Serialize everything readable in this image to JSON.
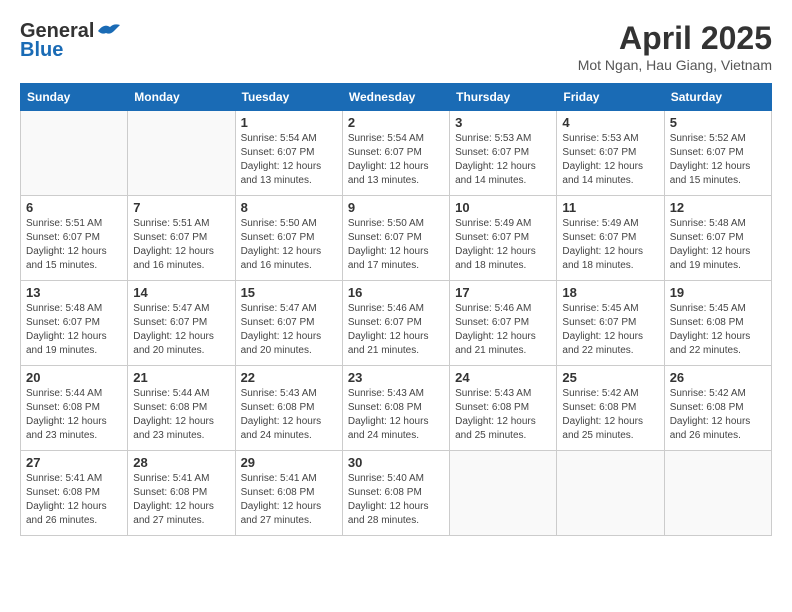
{
  "header": {
    "logo_general": "General",
    "logo_blue": "Blue",
    "month_year": "April 2025",
    "location": "Mot Ngan, Hau Giang, Vietnam"
  },
  "calendar": {
    "days_of_week": [
      "Sunday",
      "Monday",
      "Tuesday",
      "Wednesday",
      "Thursday",
      "Friday",
      "Saturday"
    ],
    "weeks": [
      [
        {
          "day": "",
          "info": ""
        },
        {
          "day": "",
          "info": ""
        },
        {
          "day": "1",
          "info": "Sunrise: 5:54 AM\nSunset: 6:07 PM\nDaylight: 12 hours\nand 13 minutes."
        },
        {
          "day": "2",
          "info": "Sunrise: 5:54 AM\nSunset: 6:07 PM\nDaylight: 12 hours\nand 13 minutes."
        },
        {
          "day": "3",
          "info": "Sunrise: 5:53 AM\nSunset: 6:07 PM\nDaylight: 12 hours\nand 14 minutes."
        },
        {
          "day": "4",
          "info": "Sunrise: 5:53 AM\nSunset: 6:07 PM\nDaylight: 12 hours\nand 14 minutes."
        },
        {
          "day": "5",
          "info": "Sunrise: 5:52 AM\nSunset: 6:07 PM\nDaylight: 12 hours\nand 15 minutes."
        }
      ],
      [
        {
          "day": "6",
          "info": "Sunrise: 5:51 AM\nSunset: 6:07 PM\nDaylight: 12 hours\nand 15 minutes."
        },
        {
          "day": "7",
          "info": "Sunrise: 5:51 AM\nSunset: 6:07 PM\nDaylight: 12 hours\nand 16 minutes."
        },
        {
          "day": "8",
          "info": "Sunrise: 5:50 AM\nSunset: 6:07 PM\nDaylight: 12 hours\nand 16 minutes."
        },
        {
          "day": "9",
          "info": "Sunrise: 5:50 AM\nSunset: 6:07 PM\nDaylight: 12 hours\nand 17 minutes."
        },
        {
          "day": "10",
          "info": "Sunrise: 5:49 AM\nSunset: 6:07 PM\nDaylight: 12 hours\nand 18 minutes."
        },
        {
          "day": "11",
          "info": "Sunrise: 5:49 AM\nSunset: 6:07 PM\nDaylight: 12 hours\nand 18 minutes."
        },
        {
          "day": "12",
          "info": "Sunrise: 5:48 AM\nSunset: 6:07 PM\nDaylight: 12 hours\nand 19 minutes."
        }
      ],
      [
        {
          "day": "13",
          "info": "Sunrise: 5:48 AM\nSunset: 6:07 PM\nDaylight: 12 hours\nand 19 minutes."
        },
        {
          "day": "14",
          "info": "Sunrise: 5:47 AM\nSunset: 6:07 PM\nDaylight: 12 hours\nand 20 minutes."
        },
        {
          "day": "15",
          "info": "Sunrise: 5:47 AM\nSunset: 6:07 PM\nDaylight: 12 hours\nand 20 minutes."
        },
        {
          "day": "16",
          "info": "Sunrise: 5:46 AM\nSunset: 6:07 PM\nDaylight: 12 hours\nand 21 minutes."
        },
        {
          "day": "17",
          "info": "Sunrise: 5:46 AM\nSunset: 6:07 PM\nDaylight: 12 hours\nand 21 minutes."
        },
        {
          "day": "18",
          "info": "Sunrise: 5:45 AM\nSunset: 6:07 PM\nDaylight: 12 hours\nand 22 minutes."
        },
        {
          "day": "19",
          "info": "Sunrise: 5:45 AM\nSunset: 6:08 PM\nDaylight: 12 hours\nand 22 minutes."
        }
      ],
      [
        {
          "day": "20",
          "info": "Sunrise: 5:44 AM\nSunset: 6:08 PM\nDaylight: 12 hours\nand 23 minutes."
        },
        {
          "day": "21",
          "info": "Sunrise: 5:44 AM\nSunset: 6:08 PM\nDaylight: 12 hours\nand 23 minutes."
        },
        {
          "day": "22",
          "info": "Sunrise: 5:43 AM\nSunset: 6:08 PM\nDaylight: 12 hours\nand 24 minutes."
        },
        {
          "day": "23",
          "info": "Sunrise: 5:43 AM\nSunset: 6:08 PM\nDaylight: 12 hours\nand 24 minutes."
        },
        {
          "day": "24",
          "info": "Sunrise: 5:43 AM\nSunset: 6:08 PM\nDaylight: 12 hours\nand 25 minutes."
        },
        {
          "day": "25",
          "info": "Sunrise: 5:42 AM\nSunset: 6:08 PM\nDaylight: 12 hours\nand 25 minutes."
        },
        {
          "day": "26",
          "info": "Sunrise: 5:42 AM\nSunset: 6:08 PM\nDaylight: 12 hours\nand 26 minutes."
        }
      ],
      [
        {
          "day": "27",
          "info": "Sunrise: 5:41 AM\nSunset: 6:08 PM\nDaylight: 12 hours\nand 26 minutes."
        },
        {
          "day": "28",
          "info": "Sunrise: 5:41 AM\nSunset: 6:08 PM\nDaylight: 12 hours\nand 27 minutes."
        },
        {
          "day": "29",
          "info": "Sunrise: 5:41 AM\nSunset: 6:08 PM\nDaylight: 12 hours\nand 27 minutes."
        },
        {
          "day": "30",
          "info": "Sunrise: 5:40 AM\nSunset: 6:08 PM\nDaylight: 12 hours\nand 28 minutes."
        },
        {
          "day": "",
          "info": ""
        },
        {
          "day": "",
          "info": ""
        },
        {
          "day": "",
          "info": ""
        }
      ]
    ]
  }
}
